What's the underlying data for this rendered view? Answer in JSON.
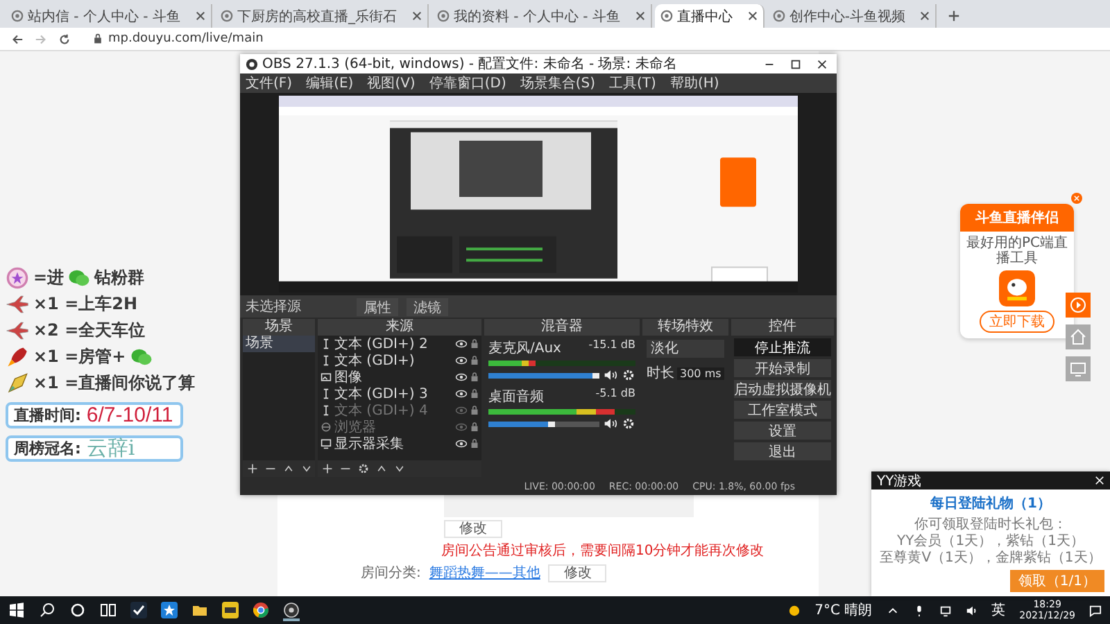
{
  "browser": {
    "tabs": [
      {
        "title": "站内信 - 个人中心 - 斗鱼",
        "selected": false
      },
      {
        "title": "下厨房的高校直播_乐街石",
        "selected": false
      },
      {
        "title": "我的资料 - 个人中心 - 斗鱼",
        "selected": false
      },
      {
        "title": "直播中心",
        "selected": true
      },
      {
        "title": "创作中心-斗鱼视频",
        "selected": false
      }
    ],
    "url": "mp.douyu.com/live/main"
  },
  "page": {
    "edit_button": "修改",
    "notice": "房间公告通过审核后，需要间隔10分钟才能再次修改",
    "category_label": "房间分类:",
    "category_value": "舞蹈热舞——其他",
    "category_button": "修改"
  },
  "overlay": {
    "rules": [
      {
        "kind": "badge",
        "text": "=进",
        "wechat": true,
        "after": "钻粉群"
      },
      {
        "kind": "plane",
        "text": "×1 =上车2H",
        "wechat": false
      },
      {
        "kind": "plane",
        "text": "×2 =全天车位",
        "wechat": false
      },
      {
        "kind": "rocket",
        "text": "×1 =房管+",
        "wechat": true
      },
      {
        "kind": "spaceship",
        "text": "×1 =直播间你说了算",
        "wechat": false
      }
    ],
    "schedule": {
      "label": "直播时间:",
      "value": "6/7-10/11"
    },
    "sponsor": {
      "label": "周榜冠名:",
      "value": "云辞i"
    }
  },
  "obs": {
    "title": "OBS 27.1.3 (64-bit, windows) - 配置文件: 未命名 - 场景: 未命名",
    "menu": [
      "文件(F)",
      "编辑(E)",
      "视图(V)",
      "停靠窗口(D)",
      "场景集合(S)",
      "工具(T)",
      "帮助(H)"
    ],
    "context": {
      "label": "未选择源",
      "buttons": [
        "属性",
        "滤镜"
      ]
    },
    "docks": {
      "scenes": "场景",
      "sources": "来源",
      "mixer": "混音器",
      "transitions": "转场特效",
      "controls": "控件"
    },
    "scenes": [
      {
        "name": "场景",
        "selected": true
      }
    ],
    "sources": [
      {
        "kind": "text",
        "name": "文本 (GDI+) 2",
        "visible": true
      },
      {
        "kind": "text",
        "name": "文本 (GDI+)",
        "visible": true
      },
      {
        "kind": "image",
        "name": "图像",
        "visible": true
      },
      {
        "kind": "text",
        "name": "文本 (GDI+) 3",
        "visible": true
      },
      {
        "kind": "text",
        "name": "文本 (GDI+) 4",
        "visible": false
      },
      {
        "kind": "browser",
        "name": "浏览器",
        "visible": false
      },
      {
        "kind": "monitor",
        "name": "显示器采集",
        "visible": true
      }
    ],
    "mixer": [
      {
        "name": "麦克风/Aux",
        "reading": "-15.1 dB",
        "meter": {
          "level": 0.32
        },
        "fader": {
          "level": 1
        }
      },
      {
        "name": "桌面音频",
        "reading": "-5.1 dB",
        "meter": {
          "level": 0.86
        },
        "fader": {
          "level": 0.6
        }
      }
    ],
    "transition": {
      "type": "淡化",
      "duration_label": "时长",
      "duration": "300 ms"
    },
    "controls": [
      {
        "label": "停止推流",
        "active": true
      },
      {
        "label": "开始录制",
        "active": false
      },
      {
        "label": "启动虚拟摄像机",
        "active": false
      },
      {
        "label": "工作室模式",
        "active": false
      },
      {
        "label": "设置",
        "active": false
      },
      {
        "label": "退出",
        "active": false
      }
    ],
    "status": {
      "live": "LIVE: 00:00:00",
      "rec": "REC: 00:00:00",
      "cpu": "CPU: 1.8%, 60.00 fps"
    }
  },
  "ad": {
    "title": "斗鱼直播伴侣",
    "subtitle": "最好用的PC端直播工具",
    "button": "立即下载"
  },
  "notification": {
    "app": "YY游戏",
    "title": "每日登陆礼物（1）",
    "lines": [
      "你可领取登陆时长礼包：",
      "YY会员（1天），紫钻（1天）",
      "至尊黄V（1天），金牌紫钻（1天）"
    ],
    "button": "领取（1/1）"
  },
  "taskbar": {
    "weather": "7°C 晴朗",
    "ime": "英",
    "time": "18:29",
    "date": "2021/12/29"
  }
}
